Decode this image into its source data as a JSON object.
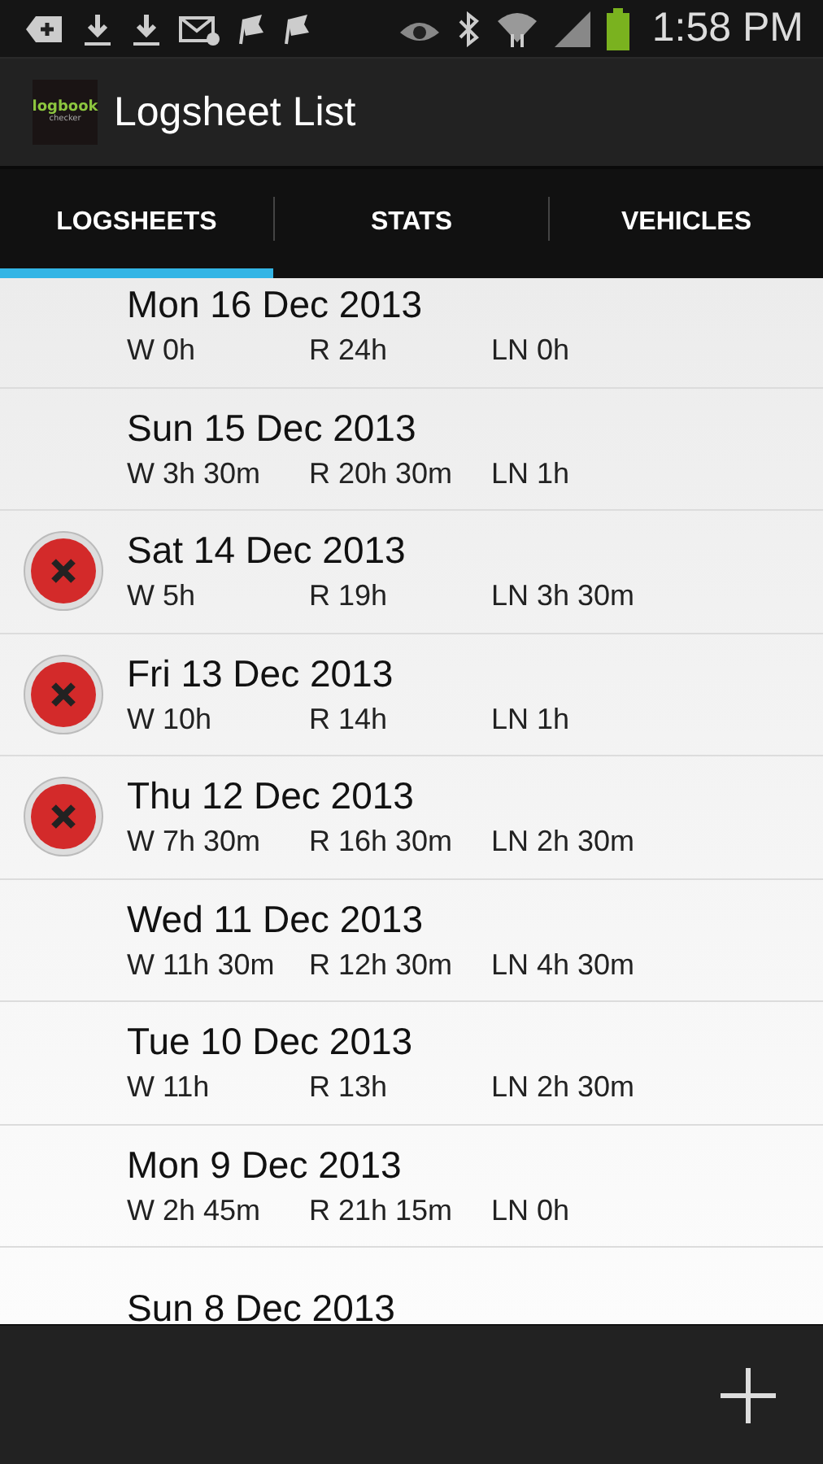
{
  "status_bar": {
    "time": "1:58 PM"
  },
  "app_bar": {
    "logo": {
      "top": "logbook",
      "bottom": "checker"
    },
    "title": "Logsheet List"
  },
  "tabs": [
    {
      "label": "LOGSHEETS",
      "selected": true
    },
    {
      "label": "STATS",
      "selected": false
    },
    {
      "label": "VEHICLES",
      "selected": false
    }
  ],
  "logsheets": [
    {
      "date": "Mon 16 Dec 2013",
      "error": false,
      "work": "W 0h",
      "rest": "R 24h",
      "ln": "LN 0h"
    },
    {
      "date": "Sun 15 Dec 2013",
      "error": false,
      "work": "W 3h 30m",
      "rest": "R 20h 30m",
      "ln": "LN 1h"
    },
    {
      "date": "Sat 14 Dec 2013",
      "error": true,
      "work": "W 5h",
      "rest": "R 19h",
      "ln": "LN 3h 30m"
    },
    {
      "date": "Fri 13 Dec 2013",
      "error": true,
      "work": "W 10h",
      "rest": "R 14h",
      "ln": "LN 1h"
    },
    {
      "date": "Thu 12 Dec 2013",
      "error": true,
      "work": "W 7h 30m",
      "rest": "R 16h 30m",
      "ln": "LN 2h 30m"
    },
    {
      "date": "Wed 11 Dec 2013",
      "error": false,
      "work": "W 11h 30m",
      "rest": "R 12h 30m",
      "ln": "LN 4h 30m"
    },
    {
      "date": "Tue 10 Dec 2013",
      "error": false,
      "work": "W 11h",
      "rest": "R 13h",
      "ln": "LN 2h 30m"
    },
    {
      "date": "Mon 9 Dec 2013",
      "error": false,
      "work": "W 2h 45m",
      "rest": "R 21h 15m",
      "ln": "LN 0h"
    },
    {
      "date": "Sun 8 Dec 2013",
      "error": false
    }
  ]
}
